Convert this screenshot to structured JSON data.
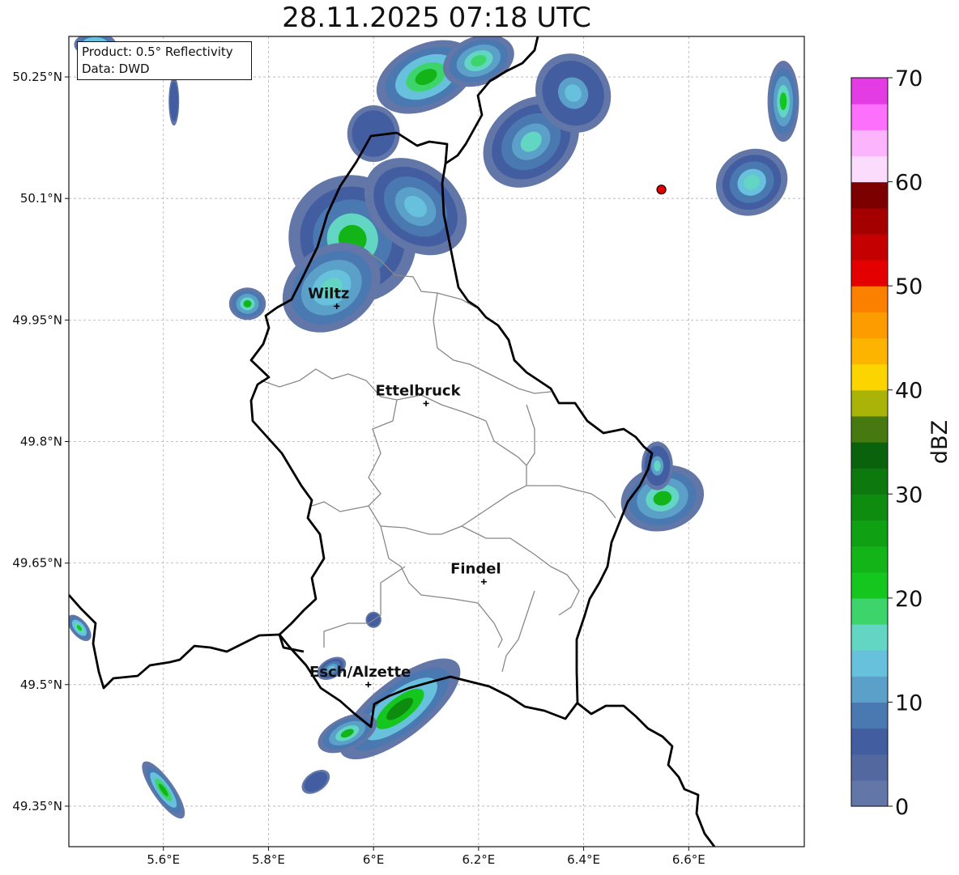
{
  "title": "28.11.2025 07:18 UTC",
  "info": {
    "product_line": "Product: 0.5° Reflectivity",
    "data_line": "Data: DWD"
  },
  "map": {
    "lon_range": [
      5.42,
      6.82
    ],
    "lat_range": [
      49.3,
      50.3
    ],
    "lon_ticks": [
      {
        "value": 5.6,
        "label": "5.6°E"
      },
      {
        "value": 5.8,
        "label": "5.8°E"
      },
      {
        "value": 6.0,
        "label": "6°E"
      },
      {
        "value": 6.2,
        "label": "6.2°E"
      },
      {
        "value": 6.4,
        "label": "6.4°E"
      },
      {
        "value": 6.6,
        "label": "6.6°E"
      }
    ],
    "lat_ticks": [
      {
        "value": 50.25,
        "label": "50.25°N"
      },
      {
        "value": 50.1,
        "label": "50.1°N"
      },
      {
        "value": 49.95,
        "label": "49.95°N"
      },
      {
        "value": 49.8,
        "label": "49.8°N"
      },
      {
        "value": 49.65,
        "label": "49.65°N"
      },
      {
        "value": 49.5,
        "label": "49.5°N"
      },
      {
        "value": 49.35,
        "label": "49.35°N"
      }
    ],
    "grid": true,
    "cities": [
      {
        "name": "Wiltz",
        "lon": 5.93,
        "lat": 49.967
      },
      {
        "name": "Ettelbruck",
        "lon": 6.1,
        "lat": 49.847
      },
      {
        "name": "Findel",
        "lon": 6.21,
        "lat": 49.627
      },
      {
        "name": "Esch/Alzette",
        "lon": 5.99,
        "lat": 49.5
      }
    ],
    "radar_site": {
      "lon": 6.548,
      "lat": 50.111,
      "color": "#e00000"
    },
    "echo_cells": [
      {
        "lon": 5.96,
        "lat": 50.05,
        "rlon": 0.12,
        "rlat": 0.08,
        "rot": -45,
        "level": 8,
        "core": 22
      },
      {
        "lon": 5.92,
        "lat": 49.99,
        "rlon": 0.1,
        "rlat": 0.05,
        "rot": -35,
        "level": 10,
        "core": 15
      },
      {
        "lon": 6.08,
        "lat": 50.09,
        "rlon": 0.08,
        "rlat": 0.07,
        "rot": -50,
        "level": 8,
        "core": 12
      },
      {
        "lon": 6.0,
        "lat": 50.18,
        "rlon": 0.05,
        "rlat": 0.035,
        "rot": 0,
        "level": 6,
        "core": 0
      },
      {
        "lon": 6.1,
        "lat": 50.25,
        "rlon": 0.1,
        "rlat": 0.04,
        "rot": -25,
        "level": 12,
        "core": 22
      },
      {
        "lon": 6.2,
        "lat": 50.27,
        "rlon": 0.07,
        "rlat": 0.03,
        "rot": -20,
        "level": 10,
        "core": 18
      },
      {
        "lon": 6.3,
        "lat": 50.17,
        "rlon": 0.1,
        "rlat": 0.05,
        "rot": -40,
        "level": 8,
        "core": 14
      },
      {
        "lon": 6.38,
        "lat": 50.23,
        "rlon": 0.07,
        "rlat": 0.05,
        "rot": -30,
        "level": 6,
        "core": 13
      },
      {
        "lon": 6.72,
        "lat": 50.12,
        "rlon": 0.07,
        "rlat": 0.04,
        "rot": -30,
        "level": 8,
        "core": 16
      },
      {
        "lon": 6.78,
        "lat": 50.22,
        "rlon": 0.03,
        "rlat": 0.05,
        "rot": 0,
        "level": 10,
        "core": 20
      },
      {
        "lon": 5.47,
        "lat": 50.29,
        "rlon": 0.04,
        "rlat": 0.015,
        "rot": 0,
        "level": 12,
        "core": 0
      },
      {
        "lon": 5.62,
        "lat": 50.22,
        "rlon": 0.01,
        "rlat": 0.03,
        "rot": 0,
        "level": 6,
        "core": 0
      },
      {
        "lon": 5.76,
        "lat": 49.97,
        "rlon": 0.035,
        "rlat": 0.02,
        "rot": 0,
        "level": 10,
        "core": 22
      },
      {
        "lon": 6.55,
        "lat": 49.73,
        "rlon": 0.08,
        "rlat": 0.04,
        "rot": -15,
        "level": 10,
        "core": 22
      },
      {
        "lon": 6.54,
        "lat": 49.77,
        "rlon": 0.03,
        "rlat": 0.03,
        "rot": 0,
        "level": 6,
        "core": 16
      },
      {
        "lon": 6.05,
        "lat": 49.47,
        "rlon": 0.14,
        "rlat": 0.035,
        "rot": -38,
        "level": 12,
        "core": 28
      },
      {
        "lon": 5.95,
        "lat": 49.44,
        "rlon": 0.06,
        "rlat": 0.02,
        "rot": -25,
        "level": 10,
        "core": 22
      },
      {
        "lon": 5.92,
        "lat": 49.52,
        "rlon": 0.03,
        "rlat": 0.012,
        "rot": -30,
        "level": 8,
        "core": 12
      },
      {
        "lon": 5.89,
        "lat": 49.38,
        "rlon": 0.03,
        "rlat": 0.012,
        "rot": -35,
        "level": 6,
        "core": 0
      },
      {
        "lon": 5.6,
        "lat": 49.37,
        "rlon": 0.065,
        "rlat": 0.013,
        "rot": 55,
        "level": 12,
        "core": 22
      },
      {
        "lon": 5.44,
        "lat": 49.57,
        "rlon": 0.03,
        "rlat": 0.01,
        "rot": 50,
        "level": 12,
        "core": 20
      },
      {
        "lon": 6.0,
        "lat": 49.58,
        "rlon": 0.015,
        "rlat": 0.01,
        "rot": 0,
        "level": 6,
        "core": 0
      }
    ]
  },
  "colorbar": {
    "label": "dBZ",
    "min": 0,
    "max": 70,
    "step": 2.5,
    "ticks": [
      {
        "value": 0,
        "label": "0"
      },
      {
        "value": 10,
        "label": "10"
      },
      {
        "value": 20,
        "label": "20"
      },
      {
        "value": 30,
        "label": "30"
      },
      {
        "value": 40,
        "label": "40"
      },
      {
        "value": 50,
        "label": "50"
      },
      {
        "value": 60,
        "label": "60"
      },
      {
        "value": 70,
        "label": "70"
      }
    ],
    "colors": [
      "#6276a8",
      "#53689f",
      "#435ea0",
      "#4a78b0",
      "#5ba0c8",
      "#68c1dc",
      "#62d6c2",
      "#3ed46c",
      "#14c61e",
      "#12b418",
      "#10a014",
      "#0e8c10",
      "#0c780e",
      "#0a620c",
      "#467a10",
      "#aab408",
      "#fcd400",
      "#fcb400",
      "#fc9c00",
      "#fc8000",
      "#e40000",
      "#c40000",
      "#a40000",
      "#7c0000",
      "#fcdcfc",
      "#fcb4fc",
      "#fc70fc",
      "#e43ce4"
    ]
  }
}
